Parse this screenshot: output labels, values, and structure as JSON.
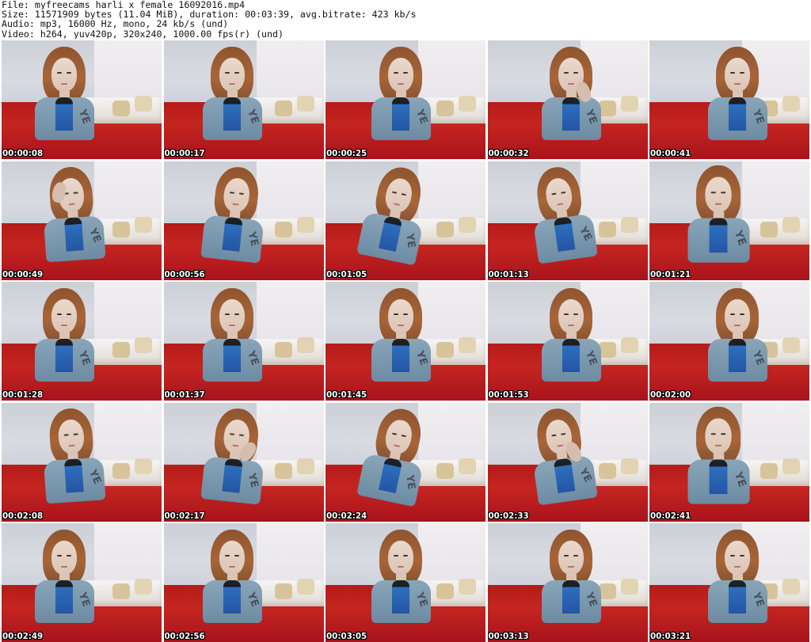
{
  "header": {
    "file": "File: myfreecams_harli_x_female_16092016.mp4",
    "size": "Size: 11571909 bytes (11.04 MiB), duration: 00:03:39, avg.bitrate: 423 kb/s",
    "audio": "Audio: mp3, 16000 Hz, mono, 24 kb/s (und)",
    "video": "Video: h264, yuv420p, 320x240, 1000.00 fps(r) (und)"
  },
  "thumbnails": [
    {
      "time": "00:00:08"
    },
    {
      "time": "00:00:17"
    },
    {
      "time": "00:00:25"
    },
    {
      "time": "00:00:32"
    },
    {
      "time": "00:00:41"
    },
    {
      "time": "00:00:49"
    },
    {
      "time": "00:00:56"
    },
    {
      "time": "00:01:05"
    },
    {
      "time": "00:01:13"
    },
    {
      "time": "00:01:21"
    },
    {
      "time": "00:01:28"
    },
    {
      "time": "00:01:37"
    },
    {
      "time": "00:01:45"
    },
    {
      "time": "00:01:53"
    },
    {
      "time": "00:02:00"
    },
    {
      "time": "00:02:08"
    },
    {
      "time": "00:02:17"
    },
    {
      "time": "00:02:24"
    },
    {
      "time": "00:02:33"
    },
    {
      "time": "00:02:41"
    },
    {
      "time": "00:02:49"
    },
    {
      "time": "00:02:56"
    },
    {
      "time": "00:03:05"
    },
    {
      "time": "00:03:13"
    },
    {
      "time": "00:03:21"
    }
  ],
  "logo_text": "YE"
}
